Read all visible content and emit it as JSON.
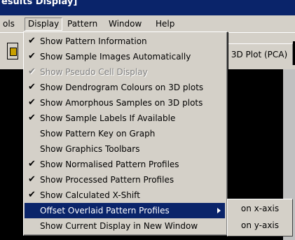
{
  "window": {
    "title": "esults Display]"
  },
  "menubar": [
    {
      "label": "ols",
      "open": false
    },
    {
      "label": "Display",
      "open": true
    },
    {
      "label": "Pattern",
      "open": false
    },
    {
      "label": "Window",
      "open": false
    },
    {
      "label": "Help",
      "open": false
    }
  ],
  "tab": {
    "label": "3D Plot (PCA)"
  },
  "display_menu": [
    {
      "label": "Show Pattern Information",
      "checked": true,
      "enabled": true
    },
    {
      "label": "Show Sample Images Automatically",
      "checked": true,
      "enabled": true
    },
    {
      "label": "Show Pseudo Cell Display",
      "checked": true,
      "enabled": false
    },
    {
      "label": "Show Dendrogram Colours on 3D plots",
      "checked": true,
      "enabled": true
    },
    {
      "label": "Show Amorphous Samples on 3D plots",
      "checked": true,
      "enabled": true
    },
    {
      "label": "Show Sample Labels If Available",
      "checked": true,
      "enabled": true
    },
    {
      "label": "Show Pattern Key on Graph",
      "checked": false,
      "enabled": true
    },
    {
      "label": "Show Graphics Toolbars",
      "checked": false,
      "enabled": true
    },
    {
      "label": "Show Normalised Pattern Profiles",
      "checked": true,
      "enabled": true
    },
    {
      "label": "Show Processed Pattern Profiles",
      "checked": true,
      "enabled": true
    },
    {
      "label": "Show Calculated X-Shift",
      "checked": true,
      "enabled": true
    },
    {
      "label": "Offset Overlaid Pattern Profiles",
      "checked": false,
      "enabled": true,
      "highlighted": true,
      "submenu": true
    },
    {
      "label": "Show Current Display in New Window",
      "checked": false,
      "enabled": true
    }
  ],
  "submenu": [
    {
      "label": "on x-axis"
    },
    {
      "label": "on y-axis"
    }
  ],
  "icons": {
    "check": "✔"
  }
}
